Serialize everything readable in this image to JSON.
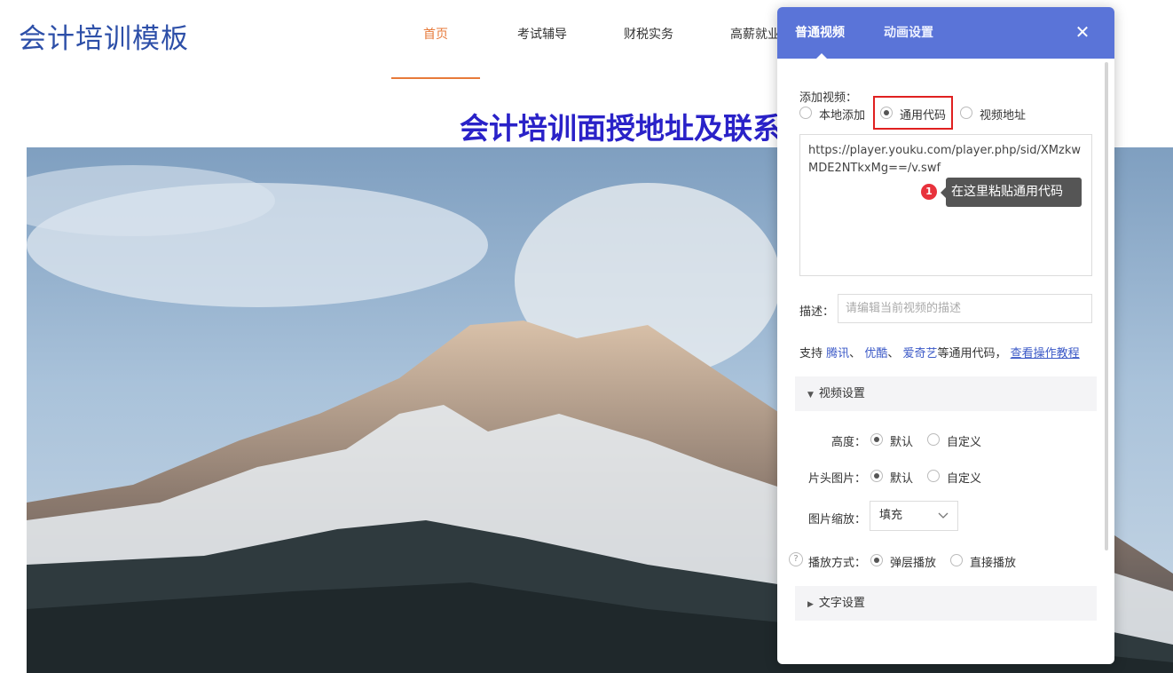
{
  "site": {
    "logo": "会计培训模板",
    "nav": [
      "首页",
      "考试辅导",
      "财税实务",
      "高薪就业"
    ],
    "hero_title": "会计培训面授地址及联系方式"
  },
  "panel": {
    "tabs": [
      "普通视频",
      "动画设置"
    ],
    "add_video_label": "添加视频：",
    "sources": [
      "本地添加",
      "通用代码",
      "视频地址"
    ],
    "code_value": "https://player.youku.com/player.php/sid/XMzkwMDE2NTkxMg==/v.swf",
    "badge": "1",
    "tooltip": "在这里粘贴通用代码",
    "desc_label": "描述：",
    "desc_placeholder": "请编辑当前视频的描述",
    "support": {
      "prefix": "支持",
      "p1": "腾讯",
      "sep": "、",
      "p2": "优酷",
      "p3": "爱奇艺",
      "suffix": "等通用代码，",
      "tutorial": "查看操作教程"
    },
    "video_settings": {
      "title": "视频设置",
      "height_label": "高度：",
      "cover_label": "片头图片：",
      "scale_label": "图片缩放：",
      "play_label": "播放方式：",
      "default": "默认",
      "custom": "自定义",
      "scale_value": "填充",
      "play_options": [
        "弹层播放",
        "直接播放"
      ]
    },
    "text_settings": "文字设置",
    "help_icon": "?"
  },
  "colors": {
    "panel_header": "#5a74d8",
    "nav_active": "#e77a3a",
    "highlight_box": "#e02020",
    "logo": "#2d4fa8",
    "hero_title": "#2a22c8"
  }
}
